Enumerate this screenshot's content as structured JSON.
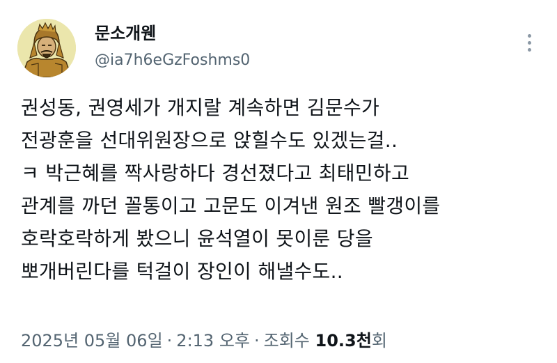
{
  "author": {
    "display_name": "문소개웬",
    "handle": "@ia7h6eGzFoshms0",
    "avatar_icon": "warrior-portrait-icon"
  },
  "more_icon": "more-vertical-icon",
  "tweet": {
    "lines": [
      "권성동, 권영세가 개지랄 계속하면 김문수가",
      "전광훈을 선대위원장으로 앉힐수도 있겠는걸..",
      "ㅋ 박근혜를 짝사랑하다 경선졌다고 최태민하고",
      "관계를 까던 꼴통이고 고문도 이겨낸 원조 빨갱이를",
      "호락호락하게 봤으니 윤석열이 못이룬 당을",
      "뽀개버린다를 턱걸이 장인이 해낼수도.."
    ]
  },
  "meta": {
    "date": "2025년 05월 06일",
    "separator1": "·",
    "time": "2:13 오후",
    "separator2": "·",
    "views_label": "조회수",
    "views_count": "10.3천",
    "views_suffix": "회"
  },
  "colors": {
    "text_primary": "#0f1419",
    "text_secondary": "#536471",
    "avatar_bg": "#e9e3a8"
  }
}
